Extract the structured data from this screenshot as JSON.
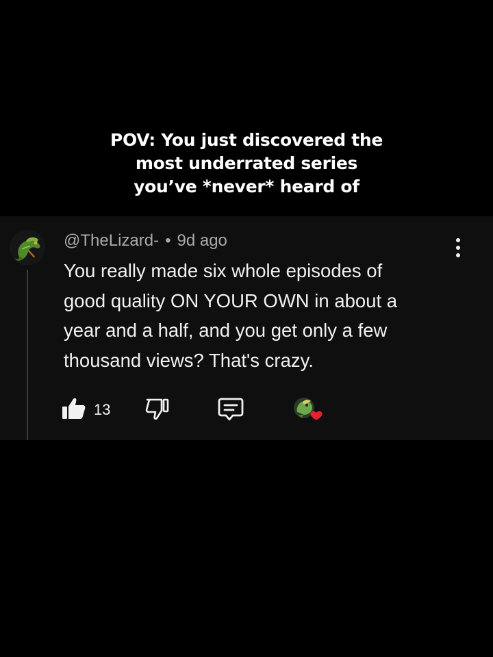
{
  "caption": {
    "line1": "POV: You just discovered the",
    "line2": "most underrated series",
    "line3": "you’ve *never* heard of"
  },
  "comment": {
    "author": "@TheLizard-",
    "separator": "•",
    "time": "9d ago",
    "text_lines": [
      "You really made six whole episodes of",
      "good quality ON YOUR OWN in about a",
      "year and a half, and you get only a few",
      "thousand views? That's crazy."
    ],
    "likes": "13",
    "avatar_icon": "lizard-avatar",
    "creator_heart_icon": "creator-heart-icon"
  },
  "colors": {
    "background": "#000000",
    "panel": "#0f0f0f",
    "text_primary": "#f1f1f1",
    "text_secondary": "#aaaaaa",
    "heart": "#e8202a"
  }
}
